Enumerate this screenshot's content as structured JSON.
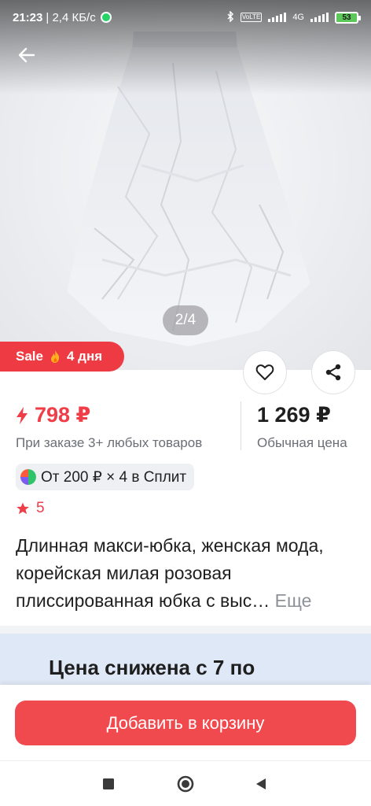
{
  "status_bar": {
    "time": "21:23",
    "network_speed": "| 2,4 КБ/с",
    "signal_labels": [
      "VoLTE",
      "4G"
    ],
    "battery": "53"
  },
  "gallery": {
    "indicator": "2/4"
  },
  "sale_badge": {
    "label": "Sale",
    "icon": "flame-icon",
    "days": "4 дня"
  },
  "price": {
    "sale": "798 ₽",
    "sale_note": "При заказе 3+ любых товаров",
    "regular": "1 269 ₽",
    "regular_note": "Обычная цена"
  },
  "split": {
    "text": "От 200 ₽ × 4 в Сплит"
  },
  "rating": {
    "value": "5"
  },
  "product": {
    "title": "Длинная макси-юбка, женская мода, корейская милая розовая плиссированная юбка с выс…",
    "more_label": "Еще"
  },
  "promo": {
    "text": "Цена снижена с 7 по"
  },
  "cart": {
    "button_label": "Добавить в корзину"
  },
  "colors": {
    "accent": "#f04a4f",
    "sale": "#ef3e47",
    "promo_bg": "#dfe8f6"
  }
}
